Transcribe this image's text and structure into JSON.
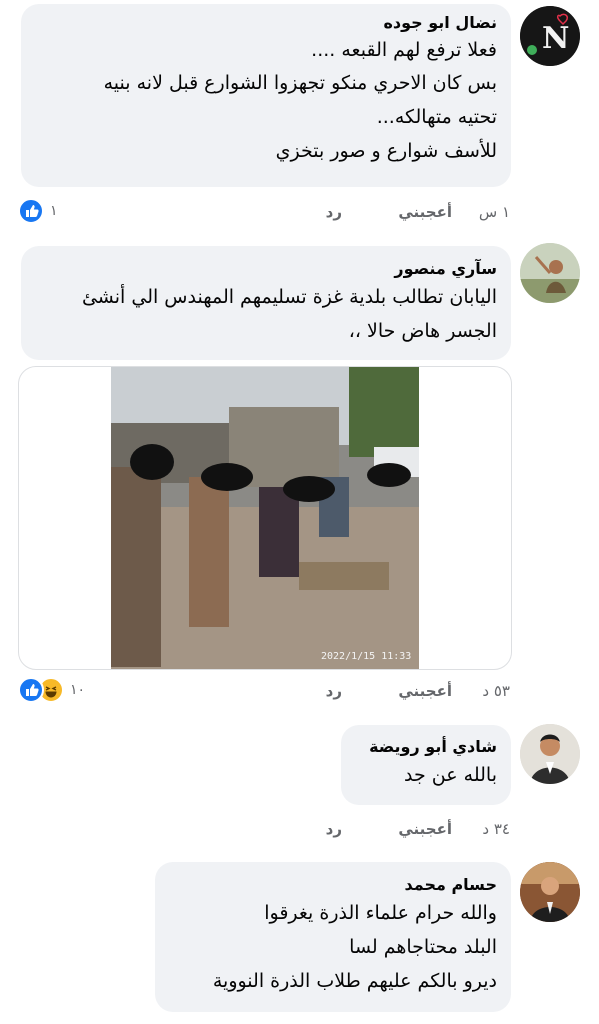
{
  "comments": [
    {
      "author": "نضال ابو جوده",
      "lines": [
        "فعلا ترفع لهم القبعه ....",
        "بس كان الاحري منكو تجهزوا الشوارع قبل لانه بنيه",
        "تحتيه متهالكه...",
        "للأسف شوارع و صور بتخزي"
      ],
      "time": "١ س",
      "like_label": "أعجبني",
      "reply_label": "رد",
      "reaction_count": "١",
      "reactions": [
        "like"
      ]
    },
    {
      "author": "سآري منصور",
      "lines": [
        "اليابان تطالب بلدية غزة تسليمهم المهندس الي أنشئ",
        "الجسر هاض حالا ،،"
      ],
      "time": "٥٣ د",
      "like_label": "أعجبني",
      "reply_label": "رد",
      "reaction_count": "١٠",
      "reactions": [
        "like",
        "haha"
      ],
      "photo_timestamp": "2022/1/15 11:33"
    },
    {
      "author": "شادي أبو رويضة",
      "lines": [
        "بالله عن جد"
      ],
      "time": "٣٤ د",
      "like_label": "أعجبني",
      "reply_label": "رد"
    },
    {
      "author": "حسام محمد",
      "lines": [
        "والله حرام علماء الذرة يغرقوا",
        "البلد محتاجاهم لسا",
        "ديرو بالكم عليهم طلاب الذرة النووية"
      ]
    }
  ],
  "colors": {
    "bubble": "#f0f2f5",
    "meta_text": "#65676b",
    "like_blue": "#1877f2",
    "haha_yellow": "#f7b928"
  }
}
